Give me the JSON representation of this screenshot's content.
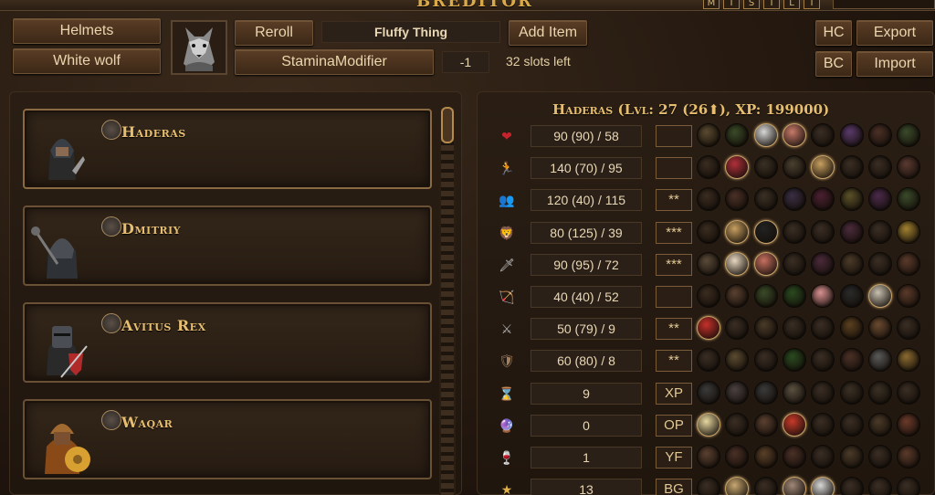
{
  "app": {
    "title": "BREDITOR"
  },
  "window_buttons": [
    "M",
    "T",
    "S",
    "T",
    "L",
    "T"
  ],
  "toolbar": {
    "helmets_label": "Helmets",
    "helmet_value": "White wolf",
    "reroll_label": "Reroll",
    "item_name": "Fluffy Thing",
    "add_item_label": "Add Item",
    "modifier_label": "StaminaModifier",
    "modifier_value": "-1",
    "slots_left": "32 slots left",
    "hc_label": "HC",
    "bc_label": "BC",
    "export_label": "Export",
    "import_label": "Import"
  },
  "roster": [
    {
      "name": "Haderas",
      "icon": "helmet-portrait",
      "class_icon": "crown-icon",
      "accent": "#3a3f46"
    },
    {
      "name": "Dmitriy",
      "icon": "mace-knight-portrait",
      "class_icon": "sword-icon",
      "accent": "#2e3236"
    },
    {
      "name": "Avitus Rex",
      "icon": "knight-shield-portrait",
      "class_icon": "axe-icon",
      "accent": "#4a2020"
    },
    {
      "name": "Waqar",
      "icon": "turban-warrior-portrait",
      "class_icon": "hammer-icon",
      "accent": "#8a4a18"
    }
  ],
  "hero_header": "Haderas (Lvl: 27 (26⬆), XP: 199000)",
  "stats": [
    {
      "icon": "heart-icon",
      "glyph": "❤",
      "color": "#c8232c",
      "value": "90 (90) / 58",
      "tag": ""
    },
    {
      "icon": "fatigue-icon",
      "glyph": "🏃",
      "color": "#c69a50",
      "value": "140 (70) / 95",
      "tag": ""
    },
    {
      "icon": "resolve-icon",
      "glyph": "👥",
      "color": "#d9a94a",
      "value": "120 (40) / 115",
      "tag": "**"
    },
    {
      "icon": "initiative-icon",
      "glyph": "🦁",
      "color": "#d9a94a",
      "value": "80 (125) / 39",
      "tag": "***"
    },
    {
      "icon": "melee-skill-icon",
      "glyph": "🗡",
      "color": "#c0c0c0",
      "value": "90 (95) / 72",
      "tag": "***"
    },
    {
      "icon": "ranged-skill-icon",
      "glyph": "🏹",
      "color": "#c69a50",
      "value": "40 (40) / 52",
      "tag": ""
    },
    {
      "icon": "melee-defense-icon",
      "glyph": "⚔",
      "color": "#b0b0b0",
      "value": "50 (79) / 9",
      "tag": "**"
    },
    {
      "icon": "ranged-defense-icon",
      "glyph": "🛡",
      "color": "#a08060",
      "value": "60 (80) / 8",
      "tag": "**"
    },
    {
      "icon": "hourglass-icon",
      "glyph": "⌛",
      "color": "#c0c8d0",
      "value": "9",
      "tag": "XP"
    },
    {
      "icon": "orb-icon",
      "glyph": "🔮",
      "color": "#6a8fd0",
      "value": "0",
      "tag": "OP"
    },
    {
      "icon": "potion-icon",
      "glyph": "🍷",
      "color": "#c05050",
      "value": "1",
      "tag": "YF"
    },
    {
      "icon": "star-icon",
      "glyph": "★",
      "color": "#e0b04a",
      "value": "13",
      "tag": "BG"
    }
  ],
  "perk_colors": [
    [
      "#5a4a30",
      "#3a4a28",
      "#d8d8d8",
      "#c87a6a",
      "#3a2e24",
      "#5a3a6a",
      "#4a3026",
      "#3a4a2a"
    ],
    [
      "#3a2c20",
      "#b0303a",
      "#3a3024",
      "#4a4030",
      "#c8a060",
      "#3a2e24",
      "#3a2e24",
      "#5a3a30"
    ],
    [
      "#3a2c20",
      "#4a3026",
      "#3a3024",
      "#3a2e44",
      "#4a2030",
      "#5a5028",
      "#4a2a4a",
      "#3a4a2a"
    ],
    [
      "#3a2c20",
      "#c8a060",
      "#222222",
      "#3a2e24",
      "#3a2e24",
      "#4a2a3a",
      "#3a2e24",
      "#a08030"
    ],
    [
      "#5a4a38",
      "#e8d8c0",
      "#c87060",
      "#3a2e24",
      "#4a2a3a",
      "#4a3a28",
      "#3a2e24",
      "#5a3a2a"
    ],
    [
      "#3a2c20",
      "#5a4030",
      "#3a4a28",
      "#2a4a20",
      "#d89090",
      "#2a2a2a",
      "#c8c0b0",
      "#5a3a2a"
    ],
    [
      "#c8302a",
      "#3a2e24",
      "#4a3a28",
      "#3a2e24",
      "#3a2e24",
      "#5a4020",
      "#6a4a30",
      "#3a2e24"
    ],
    [
      "#3a2e24",
      "#5a4a30",
      "#3a2e24",
      "#2a4a20",
      "#3a2e24",
      "#4a3026",
      "#5a5a5a",
      "#8a6a30"
    ],
    [
      "#3a3a3a",
      "#4a4040",
      "#3a3a3a",
      "#5a5040",
      "#3a2e24",
      "#3a3024",
      "#3a3024",
      "#3a2e24"
    ],
    [
      "#e8d8a0",
      "#3a2e24",
      "#5a4030",
      "#c83a2a",
      "#3a2e24",
      "#3a2e24",
      "#4a3a28",
      "#6a3a2a"
    ],
    [
      "#5a4030",
      "#4a3026",
      "#5a4028",
      "#4a3026",
      "#3a2e24",
      "#4a3a28",
      "#3a2e24",
      "#5a3a2a"
    ],
    [
      "#3a2e24",
      "#c8a870",
      "#3a2e24",
      "#a08878",
      "#d8d8d8",
      "#3a2e24",
      "#3a2e24",
      "#3a2e24"
    ]
  ],
  "perk_on": [
    [
      false,
      false,
      true,
      true,
      false,
      false,
      false,
      false
    ],
    [
      false,
      true,
      false,
      false,
      true,
      false,
      false,
      false
    ],
    [
      false,
      false,
      false,
      false,
      false,
      false,
      false,
      false
    ],
    [
      false,
      true,
      true,
      false,
      false,
      false,
      false,
      false
    ],
    [
      false,
      true,
      true,
      false,
      false,
      false,
      false,
      false
    ],
    [
      false,
      false,
      false,
      false,
      false,
      false,
      true,
      false
    ],
    [
      true,
      false,
      false,
      false,
      false,
      false,
      false,
      false
    ],
    [
      false,
      false,
      false,
      false,
      false,
      false,
      false,
      false
    ],
    [
      false,
      false,
      false,
      false,
      false,
      false,
      false,
      false
    ],
    [
      true,
      false,
      false,
      true,
      false,
      false,
      false,
      false
    ],
    [
      false,
      false,
      false,
      false,
      false,
      false,
      false,
      false
    ],
    [
      false,
      true,
      false,
      true,
      true,
      false,
      false,
      false
    ]
  ]
}
